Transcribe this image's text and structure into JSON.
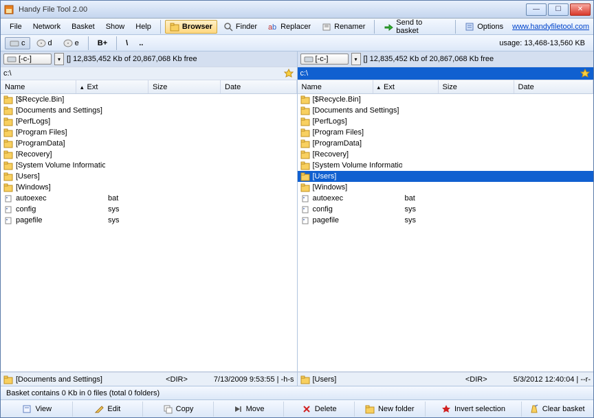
{
  "title": "Handy File Tool 2.00",
  "menu": [
    "File",
    "Network",
    "Basket",
    "Show",
    "Help"
  ],
  "tools": {
    "browser": "Browser",
    "finder": "Finder",
    "replacer": "Replacer",
    "renamer": "Renamer",
    "send": "Send to basket",
    "options": "Options"
  },
  "link": "www.handyfiletool.com",
  "drives": [
    "c",
    "d",
    "e",
    "B+",
    "\\",
    ".."
  ],
  "usage": "usage: 13,468-13,560 KB",
  "drivesel": "[-c-]",
  "freespace": "[] 12,835,452 Kb of 20,867,068 Kb free",
  "path": "c:\\",
  "cols": {
    "name": "Name",
    "ext": "Ext",
    "size": "Size",
    "date": "Date"
  },
  "folders": [
    "[$Recycle.Bin]",
    "[Documents and Settings]",
    "[PerfLogs]",
    "[Program Files]",
    "[ProgramData]",
    "[Recovery]",
    "[System Volume Information]",
    "[Users]",
    "[Windows]"
  ],
  "files": [
    {
      "name": "autoexec",
      "ext": "bat"
    },
    {
      "name": "config",
      "ext": "sys"
    },
    {
      "name": "pagefile",
      "ext": "sys"
    }
  ],
  "left": {
    "sel": "[Documents and Settings]",
    "dir": "<DIR>",
    "date": "7/13/2009 9:53:55 | -h-s"
  },
  "right": {
    "sel": "[Users]",
    "dir": "<DIR>",
    "date": "5/3/2012 12:40:04 | --r-"
  },
  "basket": "Basket contains 0 Kb in 0 files (total 0 folders)",
  "bottom": {
    "view": "View",
    "edit": "Edit",
    "copy": "Copy",
    "move": "Move",
    "delete": "Delete",
    "newfolder": "New folder",
    "invert": "Invert selection",
    "clear": "Clear basket"
  }
}
